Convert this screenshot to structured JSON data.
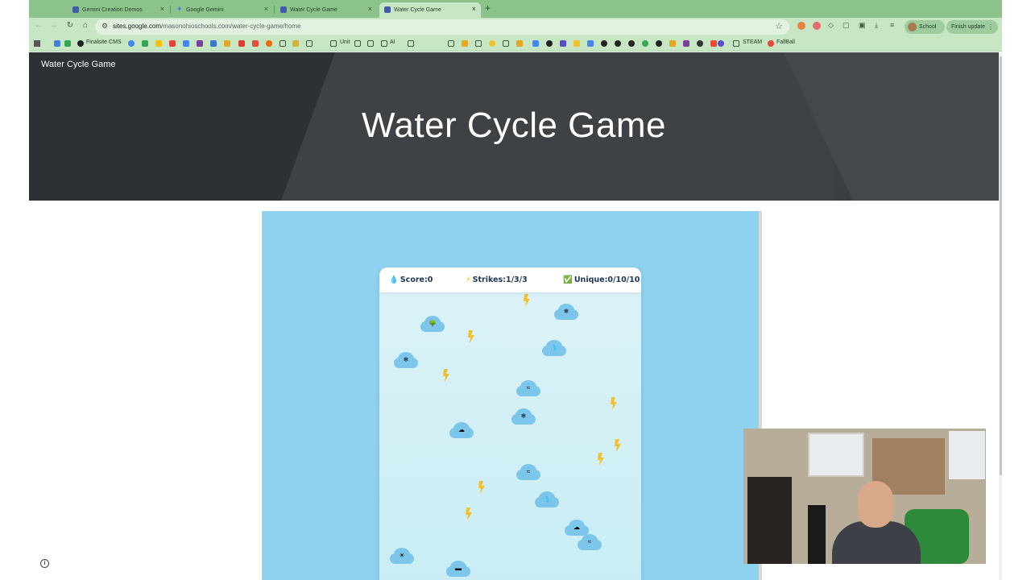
{
  "browser": {
    "tabs": [
      {
        "title": "Gemini Creation Demos",
        "active": false
      },
      {
        "title": "Google Gemini",
        "active": false
      },
      {
        "title": "Water Cycle Game",
        "active": false
      },
      {
        "title": "Water Cycle Game",
        "active": true
      }
    ],
    "new_tab": "+",
    "url_host": "sites.google.com",
    "url_path": "/masonohioschools.com/water-cycle-game/home",
    "profile_label": "School",
    "update_label": "Finish update",
    "bookmarks": [
      {
        "label": "Finalsite CMS"
      },
      {
        "label": "Unit"
      },
      {
        "label": "AI"
      },
      {
        "label": "STEAM"
      },
      {
        "label": "FallBall"
      }
    ]
  },
  "site": {
    "name": "Water Cycle Game",
    "title": "Water Cycle Game"
  },
  "game": {
    "score_label": "Score:0",
    "strikes_label": "Strikes:1/3/3",
    "unique_label": "Unique:0/10/10",
    "icons": {
      "score": "droplet-icon",
      "strikes": "lightning-icon",
      "unique": "checkbox-icon"
    }
  },
  "colors": {
    "tab_strip": "#8bc38a",
    "toolbar": "#c7e6c4",
    "header_bg": "#3b3e40",
    "game_bg": "#90d3f0",
    "cloud": "#7cc6ec",
    "bolt": "#f2c12e"
  }
}
